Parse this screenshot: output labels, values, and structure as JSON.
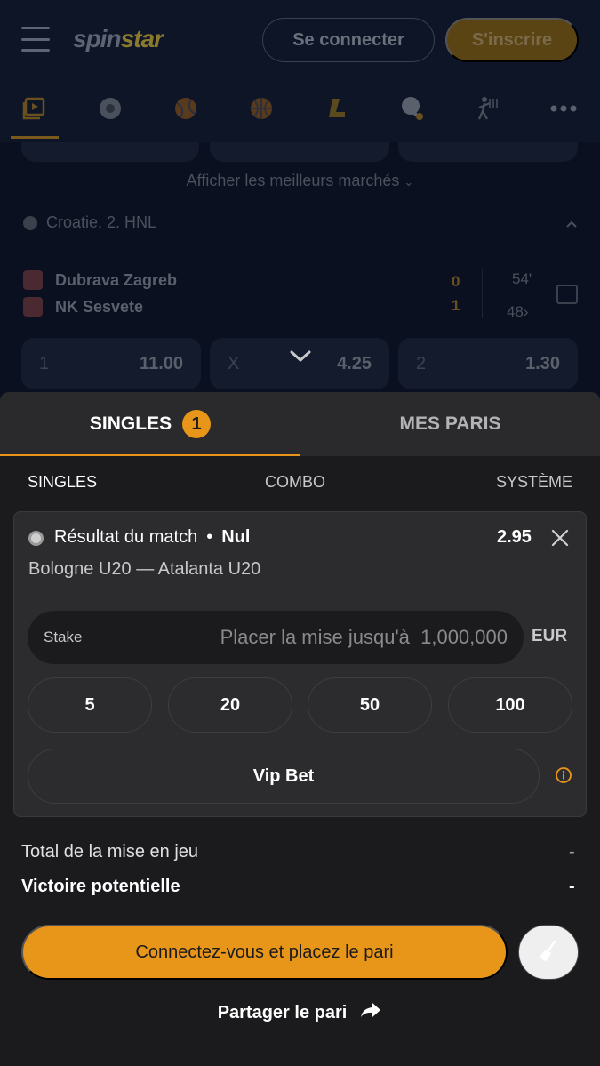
{
  "header": {
    "logo_part1": "spin",
    "logo_part2": "star",
    "login_label": "Se connecter",
    "register_label": "S'inscrire"
  },
  "sports_nav": {
    "icons": [
      "live-icon",
      "soccer-icon",
      "tennis-icon",
      "basketball-icon",
      "ice-hockey-icon",
      "table-tennis-icon",
      "volleyball-icon",
      "more-icon"
    ]
  },
  "background": {
    "show_markets": "Afficher les meilleurs marchés",
    "league": "Croatie, 2. HNL",
    "team1": "Dubrava Zagreb",
    "team2": "NK Sesvete",
    "score1": "0",
    "score2": "1",
    "minute": "54'",
    "markets_count": "48",
    "odds": [
      {
        "label": "1",
        "value": "11.00"
      },
      {
        "label": "X",
        "value": "4.25"
      },
      {
        "label": "2",
        "value": "1.30"
      }
    ]
  },
  "slip": {
    "tab_singles": "SINGLES",
    "tab_singles_count": "1",
    "tab_my_bets": "MES PARIS",
    "bet_types": [
      "SINGLES",
      "COMBO",
      "SYSTÈME"
    ],
    "selection": {
      "market": "Résultat du match",
      "separator": "•",
      "pick": "Nul",
      "odds": "2.95",
      "match": "Bologne U20 — Atalanta U20"
    },
    "stake_label": "Stake",
    "stake_placeholder": "Placer la mise jusqu'à  1,000,000",
    "currency": "EUR",
    "quick_stakes": [
      "5",
      "20",
      "50",
      "100"
    ],
    "vip_label": "Vip Bet",
    "total_stake_label": "Total de la mise en jeu",
    "total_stake_value": "-",
    "potential_win_label": "Victoire potentielle",
    "potential_win_value": "-",
    "cta_label": "Connectez-vous et placez le pari",
    "share_label": "Partager le pari"
  },
  "colors": {
    "accent": "#e8961a",
    "panel": "#1b1b1d",
    "card": "#2c2c2e",
    "background": "#0a1020"
  }
}
